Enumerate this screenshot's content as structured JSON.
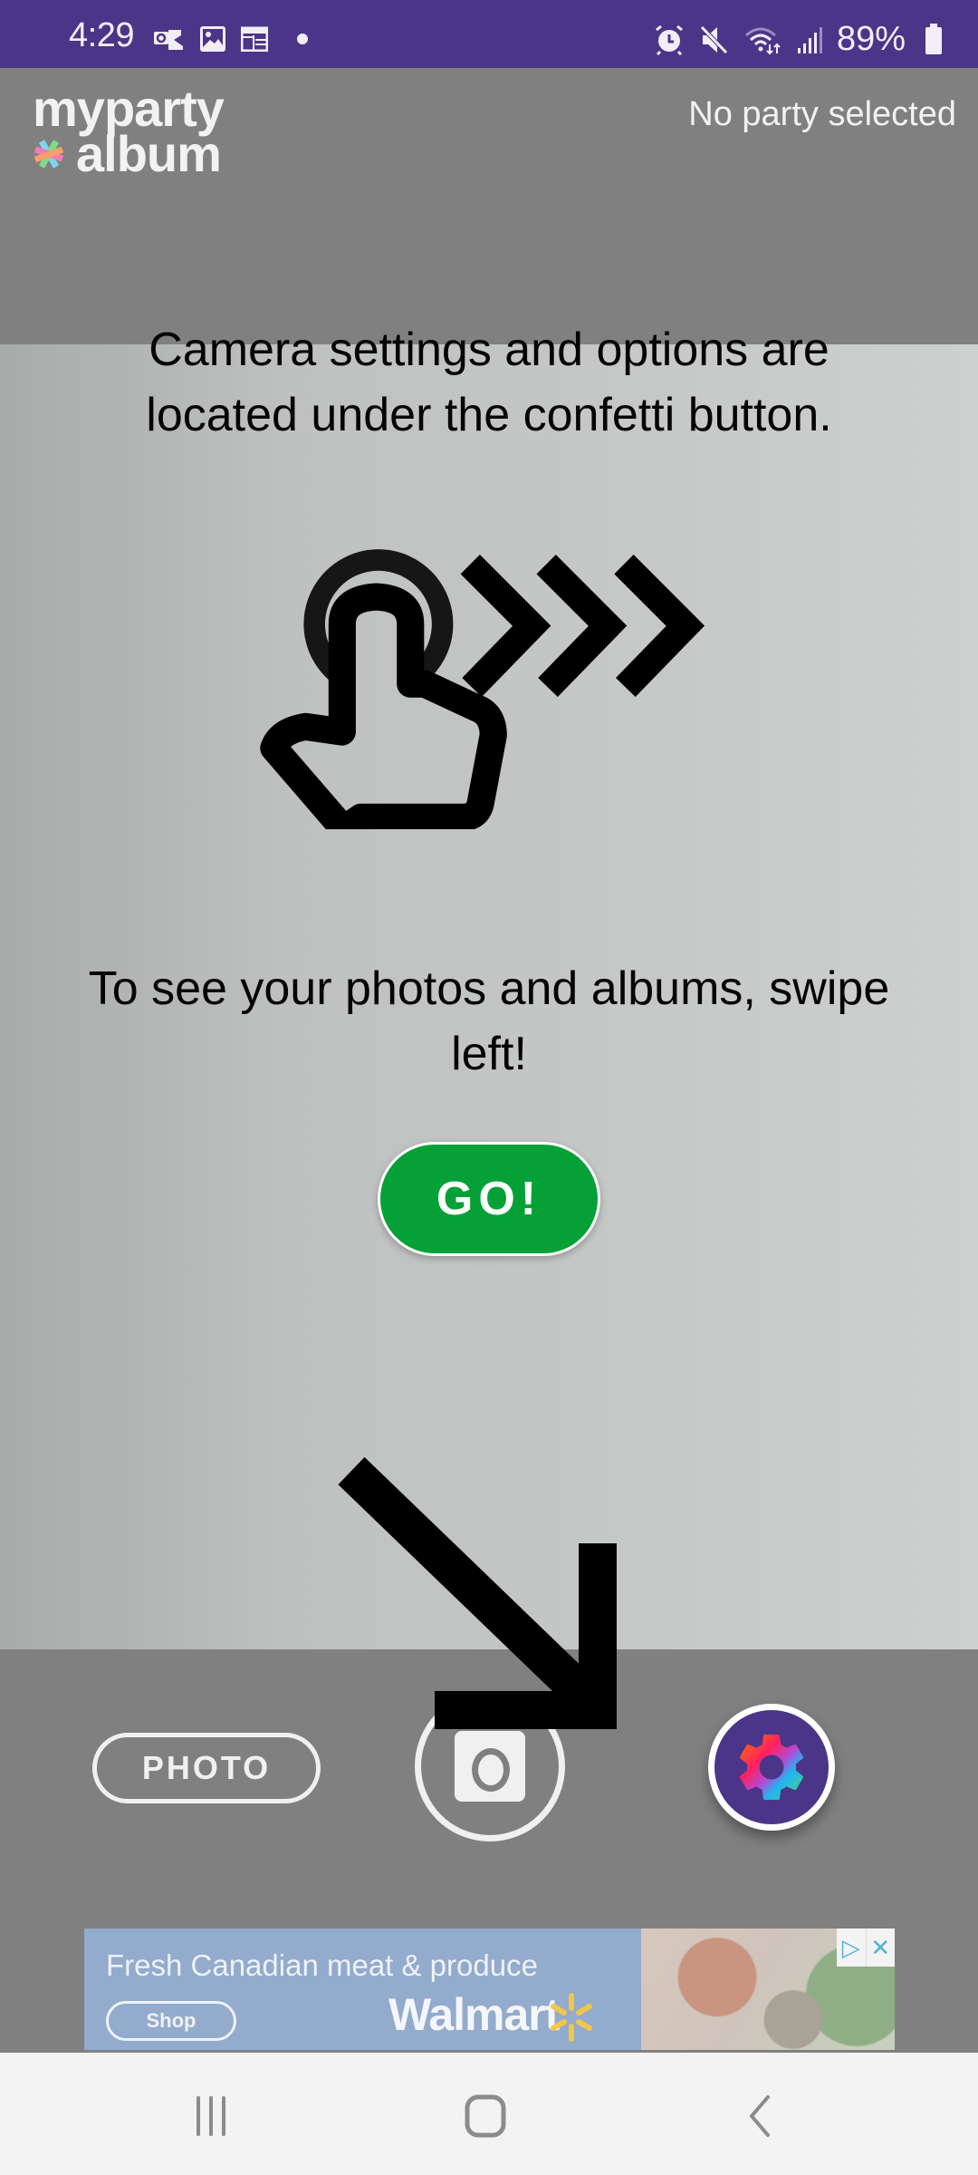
{
  "status_bar": {
    "time": "4:29",
    "left_icons": [
      "outlook-icon",
      "gallery-icon",
      "calendar-icon",
      "notification-dot-icon"
    ],
    "right_icons": [
      "alarm-icon",
      "mute-icon",
      "wifi-icon",
      "signal-icon"
    ],
    "battery_percent": "89%"
  },
  "header": {
    "logo_line1": "myparty",
    "logo_line2": "album",
    "party_status": "No party selected"
  },
  "tutorial": {
    "settings_tip": "Camera settings and options are located under the confetti button.",
    "swipe_tip": "To see your photos and albums, swipe left!",
    "go_label": "GO!"
  },
  "controls": {
    "mode_label": "PHOTO",
    "shutter_icon": "camera-icon",
    "settings_icon": "confetti-gear-icon"
  },
  "ad": {
    "headline": "Fresh Canadian meat & produce",
    "cta": "Shop",
    "brand": "Walmart",
    "adchoices_icon": "▷",
    "close_icon": "✕"
  },
  "nav": {
    "recents": "recents-icon",
    "home": "home-icon",
    "back": "back-icon"
  },
  "colors": {
    "status_bar": "#4b3588",
    "go_green": "#05a136",
    "settings_purple": "#4b3588",
    "ad_blue": "#93abcc"
  }
}
